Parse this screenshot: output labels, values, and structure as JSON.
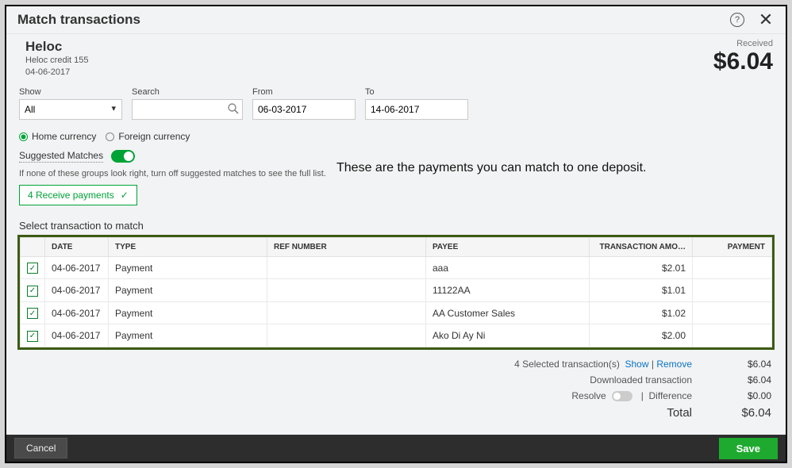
{
  "header": {
    "title": "Match transactions"
  },
  "account": {
    "name": "Heloc",
    "desc": "Heloc credit 155",
    "date": "04-06-2017",
    "received_label": "Received",
    "amount": "$6.04"
  },
  "filters": {
    "show_label": "Show",
    "show_value": "All",
    "search_label": "Search",
    "search_value": "",
    "from_label": "From",
    "from_value": "06-03-2017",
    "to_label": "To",
    "to_value": "14-06-2017"
  },
  "currency": {
    "home": "Home currency",
    "foreign": "Foreign currency"
  },
  "suggested": {
    "label": "Suggested Matches",
    "hint": "If none of these groups look right, turn off suggested matches to see the full list.",
    "pill": "4 Receive payments"
  },
  "annotation": "These are the payments you can match to one deposit.",
  "table_title": "Select transaction to match",
  "columns": {
    "date": "DATE",
    "type": "TYPE",
    "ref": "REF NUMBER",
    "payee": "PAYEE",
    "amount": "TRANSACTION AMO…",
    "payment": "PAYMENT"
  },
  "rows": [
    {
      "date": "04-06-2017",
      "type": "Payment",
      "ref": "",
      "payee": "aaa",
      "amount": "$2.01",
      "payment": ""
    },
    {
      "date": "04-06-2017",
      "type": "Payment",
      "ref": "",
      "payee": "11122AA",
      "amount": "$1.01",
      "payment": ""
    },
    {
      "date": "04-06-2017",
      "type": "Payment",
      "ref": "",
      "payee": "AA Customer Sales",
      "amount": "$1.02",
      "payment": ""
    },
    {
      "date": "04-06-2017",
      "type": "Payment",
      "ref": "",
      "payee": "Ako Di Ay Ni",
      "amount": "$2.00",
      "payment": ""
    }
  ],
  "totals": {
    "selected_label": "4 Selected transaction(s)",
    "show_link": "Show",
    "remove_link": "Remove",
    "selected_value": "$6.04",
    "downloaded_label": "Downloaded transaction",
    "downloaded_value": "$6.04",
    "resolve_label": "Resolve",
    "difference_label": "Difference",
    "difference_value": "$0.00",
    "total_label": "Total",
    "total_value": "$6.04"
  },
  "footer": {
    "cancel": "Cancel",
    "save": "Save"
  }
}
